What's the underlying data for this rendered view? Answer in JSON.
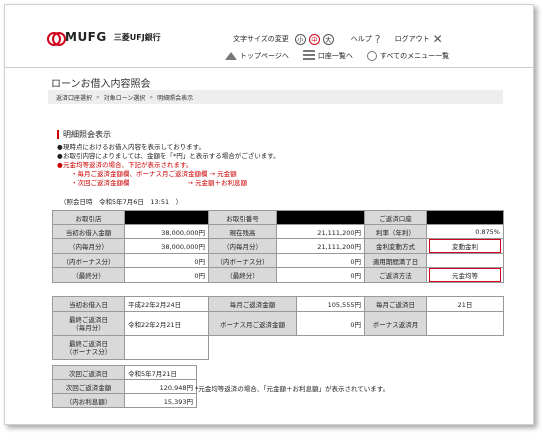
{
  "brand": {
    "logo_text": "MUFG",
    "bank_name": "三菱UFJ銀行"
  },
  "util": {
    "font_size_label": "文字サイズの変更",
    "sizes": [
      "小",
      "中",
      "大"
    ],
    "help": "ヘルプ",
    "logout": "ログアウト"
  },
  "nav": {
    "top": "トップページへ",
    "account_list": "口座一覧へ",
    "all_menu": "すべてのメニュー一覧"
  },
  "page_title": "ローンお借入内容照会",
  "breadcrumb": [
    "返済口座選択",
    "対象ローン選択",
    "明細照会表示"
  ],
  "section_title": "明細照会表示",
  "notes": {
    "n1": "現時点におけるお借入内容を表示しております。",
    "n2": "お取引内容によりましては、金額を「*円」と表示する場合がございます。",
    "n3": "元金均等返済の場合、下記が表示されます。",
    "n3a": "・毎月ご返済金額欄、ボーナス月ご返済金額欄 → 元金額",
    "n3b": "・次回ご返済金額欄",
    "n3c": "→ 元金額＋お利息額"
  },
  "date_label": "（照会日時　令和5年7月6日　13:51　）",
  "table1": {
    "r0": {
      "a": "お取引店",
      "c": "お取引番号",
      "e": "ご返済口座"
    },
    "r1": {
      "a": "当初お借入金額",
      "b": "38,000,000円",
      "c": "現在残高",
      "d": "21,111,200円",
      "e": "利率（年利）",
      "f": "0.875%"
    },
    "r2": {
      "a": "（内毎月分）",
      "b": "38,000,000円",
      "c": "（内毎月分）",
      "d": "21,111,200円",
      "e": "金利変動方式",
      "f": "変動金利"
    },
    "r3": {
      "a": "（内ボーナス分）",
      "b": "0円",
      "c": "（内ボーナス分）",
      "d": "0円",
      "e": "適用期間満了日",
      "f": ""
    },
    "r4": {
      "a": "（最終分）",
      "b": "0円",
      "c": "（最終分）",
      "d": "0円",
      "e": "ご返済方法",
      "f": "元金均等"
    }
  },
  "table2": {
    "r1": {
      "a": "当初お借入日",
      "b": "平成22年2月24日",
      "c": "毎月ご返済金額",
      "d": "105,555円",
      "e": "毎月ご返済日",
      "f": "21日"
    },
    "r2": {
      "a": "最終ご返済日\n（毎月分）",
      "b": "令和22年2月21日",
      "c": "ボーナス月ご返済金額",
      "d": "0円",
      "e": "ボーナス返済月",
      "f": ""
    },
    "r3": {
      "a": "最終ご返済日\n（ボーナス分）",
      "b": ""
    }
  },
  "table3": {
    "r1": {
      "a": "次回ご返済日",
      "b": "令和5年7月21日"
    },
    "r2": {
      "a": "次回ご返済金額",
      "b": "120,948円"
    },
    "r3": {
      "a": "（内お利息額）",
      "b": "15,393円"
    }
  },
  "footnote": "*元金均等返済の場合、「元金額＋お利息額」が表示されています。",
  "colors": {
    "accent": "#d0021b",
    "header_cell": "#d9d9d9"
  }
}
